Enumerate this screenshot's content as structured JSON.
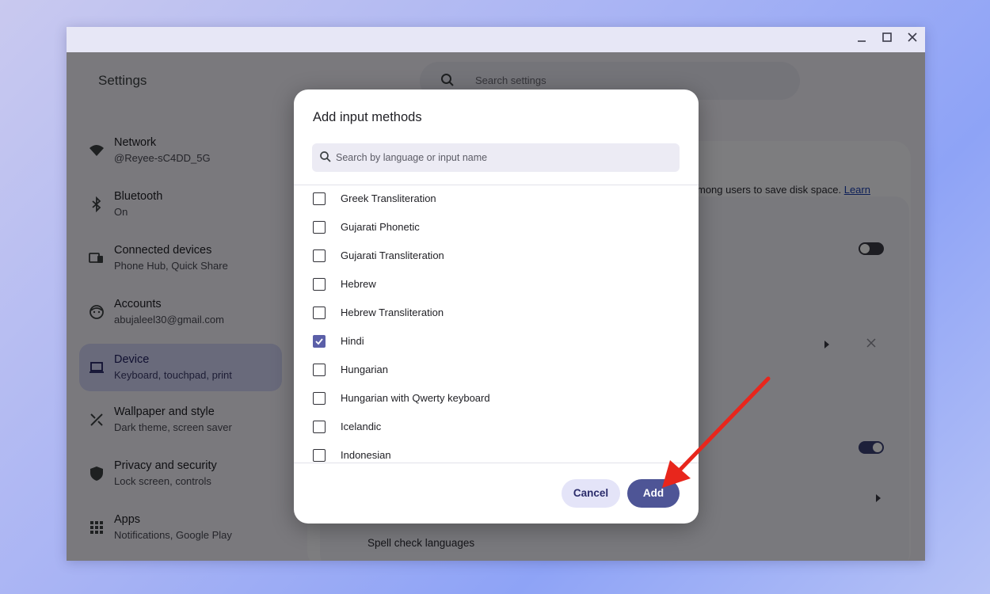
{
  "app": {
    "title": "Settings"
  },
  "window_controls": {
    "minimize": "_",
    "maximize": "□",
    "close": "✕"
  },
  "search": {
    "placeholder": "Search settings"
  },
  "sidebar": {
    "items": [
      {
        "title": "Network",
        "subtitle": "@Reyee-sC4DD_5G",
        "icon": "wifi-icon"
      },
      {
        "title": "Bluetooth",
        "subtitle": "On",
        "icon": "bluetooth-icon"
      },
      {
        "title": "Connected devices",
        "subtitle": "Phone Hub, Quick Share",
        "icon": "devices-icon"
      },
      {
        "title": "Accounts",
        "subtitle": "abujaleel30@gmail.com",
        "icon": "account-icon"
      },
      {
        "title": "Device",
        "subtitle": "Keyboard, touchpad, print",
        "icon": "laptop-icon",
        "active": true
      },
      {
        "title": "Wallpaper and style",
        "subtitle": "Dark theme, screen saver",
        "icon": "palette-icon"
      },
      {
        "title": "Privacy and security",
        "subtitle": "Lock screen, controls",
        "icon": "shield-icon"
      },
      {
        "title": "Apps",
        "subtitle": "Notifications, Google Play",
        "icon": "apps-grid-icon"
      }
    ]
  },
  "background_content": {
    "note_text": "mong users to save disk space.",
    "note_link": "Learn",
    "spell_check_label": "Spell check languages"
  },
  "dialog": {
    "title": "Add input methods",
    "search_placeholder": "Search by language or input name",
    "items": [
      {
        "label": "Greek Transliteration",
        "checked": false
      },
      {
        "label": "Gujarati Phonetic",
        "checked": false
      },
      {
        "label": "Gujarati Transliteration",
        "checked": false
      },
      {
        "label": "Hebrew",
        "checked": false
      },
      {
        "label": "Hebrew Transliteration",
        "checked": false
      },
      {
        "label": "Hindi",
        "checked": true
      },
      {
        "label": "Hungarian",
        "checked": false
      },
      {
        "label": "Hungarian with Qwerty keyboard",
        "checked": false
      },
      {
        "label": "Icelandic",
        "checked": false
      },
      {
        "label": "Indonesian",
        "checked": false
      }
    ],
    "cancel_label": "Cancel",
    "add_label": "Add"
  },
  "colors": {
    "accent": "#4e5596",
    "annotation_arrow": "#e8261c",
    "checkbox_checked": "#5b5fa8"
  }
}
